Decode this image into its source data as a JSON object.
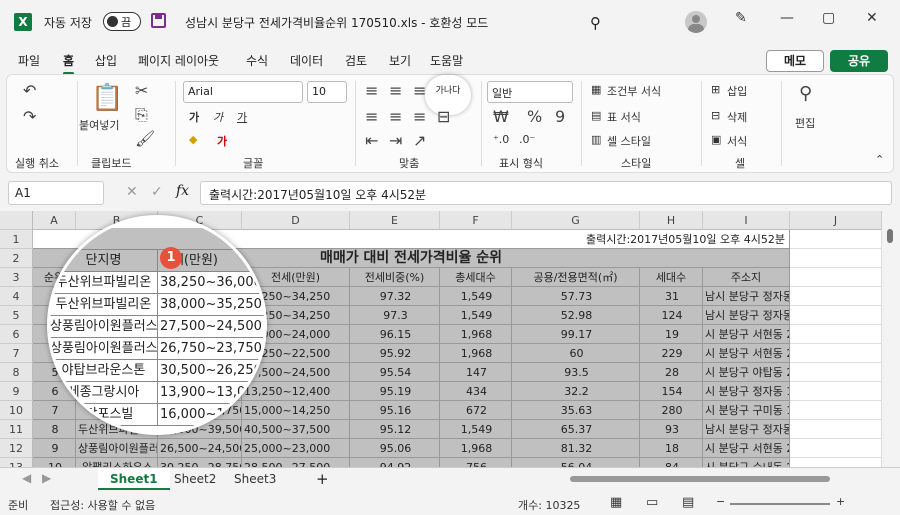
{
  "titlebar": {
    "autosave_label": "자동 저장",
    "toggle_label": "끔",
    "doc_title": "성남시 분당구 전세가격비율순위 170510.xls  -  호환성 모드",
    "minimize": "—",
    "restore": "▢",
    "close": "✕"
  },
  "menu": {
    "tabs": [
      "파일",
      "홈",
      "삽입",
      "페이지 레이아웃",
      "수식",
      "데이터",
      "검토",
      "보기",
      "도움말"
    ],
    "memo": "메모",
    "share": "공유"
  },
  "ribbon": {
    "undo_group": "실행 취소",
    "paste": "붙여넣기",
    "clipboard_group": "클립보드",
    "font_name": "Arial",
    "font_size": "10",
    "font_group": "글꼴",
    "align_group": "맞춤",
    "number_format": "일반",
    "number_group": "표시 형식",
    "cond_format": "조건부 서식",
    "table_format": "표 서식",
    "cell_style": "셀 스타일",
    "style_group": "스타일",
    "insert": "삽입",
    "delete": "삭제",
    "format": "서식",
    "cells_group": "셀",
    "edit": "편집",
    "wrap_text": "가나다"
  },
  "formula": {
    "namebox": "A1",
    "content": "출력시간:2017년05월10일 오후 4시52분"
  },
  "sheet": {
    "columns": [
      "A",
      "B",
      "C",
      "D",
      "E",
      "F",
      "G",
      "H",
      "I",
      "J"
    ],
    "rows": [
      "1",
      "2",
      "3",
      "4",
      "5",
      "6",
      "7",
      "8",
      "9",
      "10",
      "11",
      "12",
      "13",
      "14"
    ],
    "print_time": "출력시간:2017년05월10일 오후 4시52분",
    "title": "매매가 대비 전세가격비율 순위",
    "headers": [
      "순위",
      "단지명",
      "매매(만원)",
      "전세(만원)",
      "전세비중(%)",
      "총세대수",
      "공용/전용면적(㎡)",
      "세대수",
      "주소지"
    ],
    "data": [
      [
        "1",
        "두산위브파빌리온",
        "38,250~36,000",
        "37,250~34,250",
        "97.32",
        "1,549",
        "57.73",
        "31",
        "남시 분당구 정자동  7"
      ],
      [
        "2",
        "두산위브파빌리온",
        "38,000~35,250",
        "37,250~34,250",
        "97.3",
        "1,549",
        "52.98",
        "124",
        "남시 분당구 정자동  7"
      ],
      [
        "3",
        "상풍림아이원플러스",
        "27,500~24,500",
        "26,000~24,000",
        "96.15",
        "1,968",
        "99.17",
        "19",
        "시 분당구 서현동  255-1"
      ],
      [
        "4",
        "상풍림아이원플러스",
        "26,750~23,750",
        "24,250~22,500",
        "95.92",
        "1,968",
        "60",
        "229",
        "시 분당구 서현동  255-1"
      ],
      [
        "5",
        "야탑브라운스톤",
        "30,500~26,250",
        "27,500~24,500",
        "95.54",
        "147",
        "93.5",
        "28",
        "시 분당구 야탑동  219-2"
      ],
      [
        "6",
        "세종그랑시아",
        "13,900~13,000",
        "13,250~12,400",
        "95.19",
        "434",
        "32.2",
        "154",
        "시 분당구 정자동  187-3"
      ],
      [
        "7",
        "분당포스빌",
        "16,000~14,750",
        "15,000~14,250",
        "95.16",
        "672",
        "35.63",
        "280",
        "시 분당구 구미동  156"
      ],
      [
        "8",
        "두산위브파빌리온",
        "42,000~39,500",
        "40,500~37,500",
        "95.12",
        "1,549",
        "65.37",
        "93",
        "남시 분당구 정자동  7"
      ],
      [
        "9",
        "상풍림아이원플러스",
        "26,500~24,500",
        "25,000~23,000",
        "95.06",
        "1,968",
        "81.32",
        "18",
        "시 분당구 서현동  255-1"
      ],
      [
        "10",
        "알팰리스하우스",
        "30,250~28,750",
        "28,500~27,500",
        "94.92",
        "756",
        "56.04",
        "84",
        "시 분당구 수내동  23-1"
      ],
      [
        "11",
        "두산위브파빌리온",
        "40,500~38,500",
        "38,000~36,250",
        "94.27",
        "1,549",
        "64.29",
        "50",
        "남시 분당구 정자동  7"
      ]
    ],
    "magnifier_b": [
      "단지명",
      "두산위브파빌리온",
      "두산위브파빌리온",
      "상풍림아이원플러스",
      "상풍림아이원플러스",
      "야탑브라운스톤",
      "세종그랑시아",
      "분당포스빌"
    ],
    "magnifier_c": [
      "매매(만원)",
      "38,250~36,000",
      "38,000~35,250",
      "27,500~24,500",
      "26,750~23,750",
      "30,500~26,250",
      "13,900~13,000",
      "16,000~14,750"
    ],
    "badge": "1"
  },
  "sheettabs": {
    "tabs": [
      "Sheet1",
      "Sheet2",
      "Sheet3"
    ],
    "add": "+"
  },
  "status": {
    "ready": "준비",
    "accessibility": "접근성: 사용할 수 없음",
    "count": "개수: 10325"
  },
  "colors": {
    "excel_green": "#107c41",
    "badge": "#e8503c",
    "gray_fill": "#c0c0c0"
  }
}
